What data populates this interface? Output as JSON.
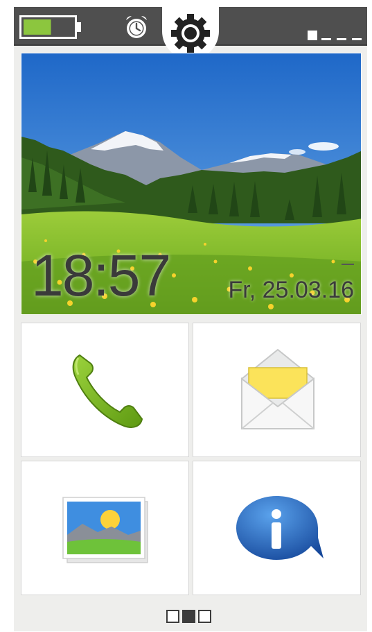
{
  "status_bar": {
    "battery_level": 0.55,
    "battery_icon": "battery-icon",
    "alarm_icon": "alarm-clock-icon",
    "settings_icon": "gear-icon",
    "signal_icon": "signal-strength-icon",
    "signal_bars_filled": 1,
    "signal_bars_total": 4
  },
  "hero": {
    "time": "18:57",
    "date": "Fr, 25.03.16"
  },
  "tiles": [
    {
      "name": "phone",
      "icon": "phone-handset-icon"
    },
    {
      "name": "messages",
      "icon": "envelope-icon"
    },
    {
      "name": "gallery",
      "icon": "photo-gallery-icon"
    },
    {
      "name": "info",
      "icon": "info-bubble-icon"
    }
  ],
  "pager": {
    "pages": 3,
    "active_index": 1
  },
  "colors": {
    "status_bar": "#4f4f4f",
    "battery_fill": "#8cc63e",
    "phone_green": "#7cb518",
    "info_blue": "#1d5ba8",
    "background": "#eeeeec"
  }
}
